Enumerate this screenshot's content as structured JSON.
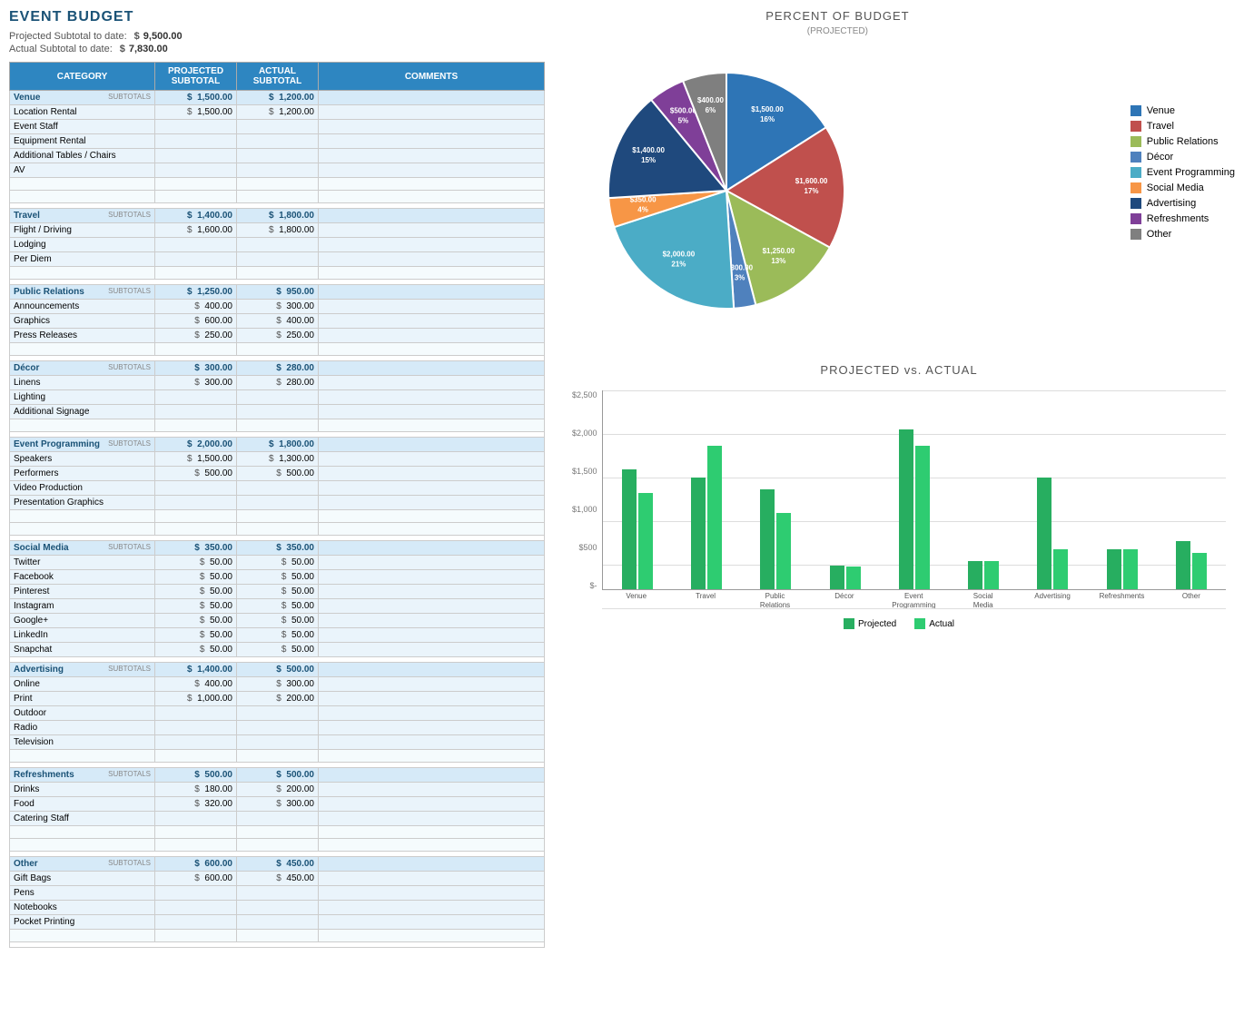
{
  "title": "EVENT BUDGET",
  "summary": {
    "projected_label": "Projected Subtotal to date:",
    "projected_dollar": "$",
    "projected_value": "9,500.00",
    "actual_label": "Actual Subtotal to date:",
    "actual_dollar": "$",
    "actual_value": "7,830.00"
  },
  "table": {
    "headers": [
      "CATEGORY",
      "PROJECTED SUBTOTAL",
      "ACTUAL SUBTOTAL",
      "COMMENTS"
    ],
    "categories": [
      {
        "name": "Venue",
        "projected": "1,500.00",
        "actual": "1,200.00",
        "items": [
          {
            "name": "Location Rental",
            "projected": "1,500.00",
            "actual": "1,200.00"
          },
          {
            "name": "Event Staff",
            "projected": "",
            "actual": ""
          },
          {
            "name": "Equipment Rental",
            "projected": "",
            "actual": ""
          },
          {
            "name": "Additional Tables / Chairs",
            "projected": "",
            "actual": ""
          },
          {
            "name": "AV",
            "projected": "",
            "actual": ""
          },
          {
            "name": "",
            "projected": "",
            "actual": ""
          },
          {
            "name": "",
            "projected": "",
            "actual": ""
          }
        ]
      },
      {
        "name": "Travel",
        "projected": "1,400.00",
        "actual": "1,800.00",
        "items": [
          {
            "name": "Flight / Driving",
            "projected": "1,600.00",
            "actual": "1,800.00"
          },
          {
            "name": "Lodging",
            "projected": "",
            "actual": ""
          },
          {
            "name": "Per Diem",
            "projected": "",
            "actual": ""
          },
          {
            "name": "",
            "projected": "",
            "actual": ""
          }
        ]
      },
      {
        "name": "Public Relations",
        "projected": "1,250.00",
        "actual": "950.00",
        "items": [
          {
            "name": "Announcements",
            "projected": "400.00",
            "actual": "300.00"
          },
          {
            "name": "Graphics",
            "projected": "600.00",
            "actual": "400.00"
          },
          {
            "name": "Press Releases",
            "projected": "250.00",
            "actual": "250.00"
          },
          {
            "name": "",
            "projected": "",
            "actual": ""
          }
        ]
      },
      {
        "name": "Décor",
        "projected": "300.00",
        "actual": "280.00",
        "items": [
          {
            "name": "Linens",
            "projected": "300.00",
            "actual": "280.00"
          },
          {
            "name": "Lighting",
            "projected": "",
            "actual": ""
          },
          {
            "name": "Additional Signage",
            "projected": "",
            "actual": ""
          },
          {
            "name": "",
            "projected": "",
            "actual": ""
          }
        ]
      },
      {
        "name": "Event Programming",
        "projected": "2,000.00",
        "actual": "1,800.00",
        "items": [
          {
            "name": "Speakers",
            "projected": "1,500.00",
            "actual": "1,300.00"
          },
          {
            "name": "Performers",
            "projected": "500.00",
            "actual": "500.00"
          },
          {
            "name": "Video Production",
            "projected": "",
            "actual": ""
          },
          {
            "name": "Presentation Graphics",
            "projected": "",
            "actual": ""
          },
          {
            "name": "",
            "projected": "",
            "actual": ""
          },
          {
            "name": "",
            "projected": "",
            "actual": ""
          }
        ]
      },
      {
        "name": "Social Media",
        "projected": "350.00",
        "actual": "350.00",
        "items": [
          {
            "name": "Twitter",
            "projected": "50.00",
            "actual": "50.00"
          },
          {
            "name": "Facebook",
            "projected": "50.00",
            "actual": "50.00"
          },
          {
            "name": "Pinterest",
            "projected": "50.00",
            "actual": "50.00"
          },
          {
            "name": "Instagram",
            "projected": "50.00",
            "actual": "50.00"
          },
          {
            "name": "Google+",
            "projected": "50.00",
            "actual": "50.00"
          },
          {
            "name": "LinkedIn",
            "projected": "50.00",
            "actual": "50.00"
          },
          {
            "name": "Snapchat",
            "projected": "50.00",
            "actual": "50.00"
          }
        ]
      },
      {
        "name": "Advertising",
        "projected": "1,400.00",
        "actual": "500.00",
        "items": [
          {
            "name": "Online",
            "projected": "400.00",
            "actual": "300.00"
          },
          {
            "name": "Print",
            "projected": "1,000.00",
            "actual": "200.00"
          },
          {
            "name": "Outdoor",
            "projected": "",
            "actual": ""
          },
          {
            "name": "Radio",
            "projected": "",
            "actual": ""
          },
          {
            "name": "Television",
            "projected": "",
            "actual": ""
          },
          {
            "name": "",
            "projected": "",
            "actual": ""
          }
        ]
      },
      {
        "name": "Refreshments",
        "projected": "500.00",
        "actual": "500.00",
        "items": [
          {
            "name": "Drinks",
            "projected": "180.00",
            "actual": "200.00"
          },
          {
            "name": "Food",
            "projected": "320.00",
            "actual": "300.00"
          },
          {
            "name": "Catering Staff",
            "projected": "",
            "actual": ""
          },
          {
            "name": "",
            "projected": "",
            "actual": ""
          },
          {
            "name": "",
            "projected": "",
            "actual": ""
          }
        ]
      },
      {
        "name": "Other",
        "projected": "600.00",
        "actual": "450.00",
        "items": [
          {
            "name": "Gift Bags",
            "projected": "600.00",
            "actual": "450.00"
          },
          {
            "name": "Pens",
            "projected": "",
            "actual": ""
          },
          {
            "name": "Notebooks",
            "projected": "",
            "actual": ""
          },
          {
            "name": "Pocket Printing",
            "projected": "",
            "actual": ""
          },
          {
            "name": "",
            "projected": "",
            "actual": ""
          }
        ]
      }
    ]
  },
  "pie_chart": {
    "title": "PERCENT OF BUDGET",
    "subtitle": "(PROJECTED)",
    "segments": [
      {
        "label": "Venue",
        "value": 16,
        "color": "#2e75b6",
        "amount": "$1,500.00"
      },
      {
        "label": "Travel",
        "value": 17,
        "color": "#c0504d",
        "amount": "$1,600.00"
      },
      {
        "label": "Public Relations",
        "value": 13,
        "color": "#9bbb59",
        "amount": "$1,250.00"
      },
      {
        "label": "Décor",
        "value": 3,
        "color": "#4f81bd",
        "amount": "$300.00"
      },
      {
        "label": "Event Programming",
        "value": 21,
        "color": "#4bacc6",
        "amount": "$2,000.00"
      },
      {
        "label": "Social Media",
        "value": 4,
        "color": "#f79646",
        "amount": "$350.00"
      },
      {
        "label": "Advertising",
        "value": 15,
        "color": "#1f497d",
        "amount": "$1,400.00"
      },
      {
        "label": "Refreshments",
        "value": 5,
        "color": "#7f3f98",
        "amount": "$500.00"
      },
      {
        "label": "Other",
        "value": 6,
        "color": "#7f7f7f",
        "amount": "$400.00"
      }
    ]
  },
  "bar_chart": {
    "title": "PROJECTED vs. ACTUAL",
    "y_labels": [
      "$2,500",
      "$2,000",
      "$1,500",
      "$1,000",
      "$500",
      "$-"
    ],
    "categories": [
      "Venue",
      "Travel",
      "Public Relations",
      "Décor",
      "Event Programming",
      "Social Media",
      "Advertising",
      "Refreshments",
      "Other"
    ],
    "projected": [
      1500,
      1400,
      1250,
      300,
      2000,
      350,
      1400,
      500,
      600
    ],
    "actual": [
      1200,
      1800,
      950,
      280,
      1800,
      350,
      500,
      500,
      450
    ],
    "max": 2500,
    "legend": [
      "Projected",
      "Actual"
    ]
  }
}
